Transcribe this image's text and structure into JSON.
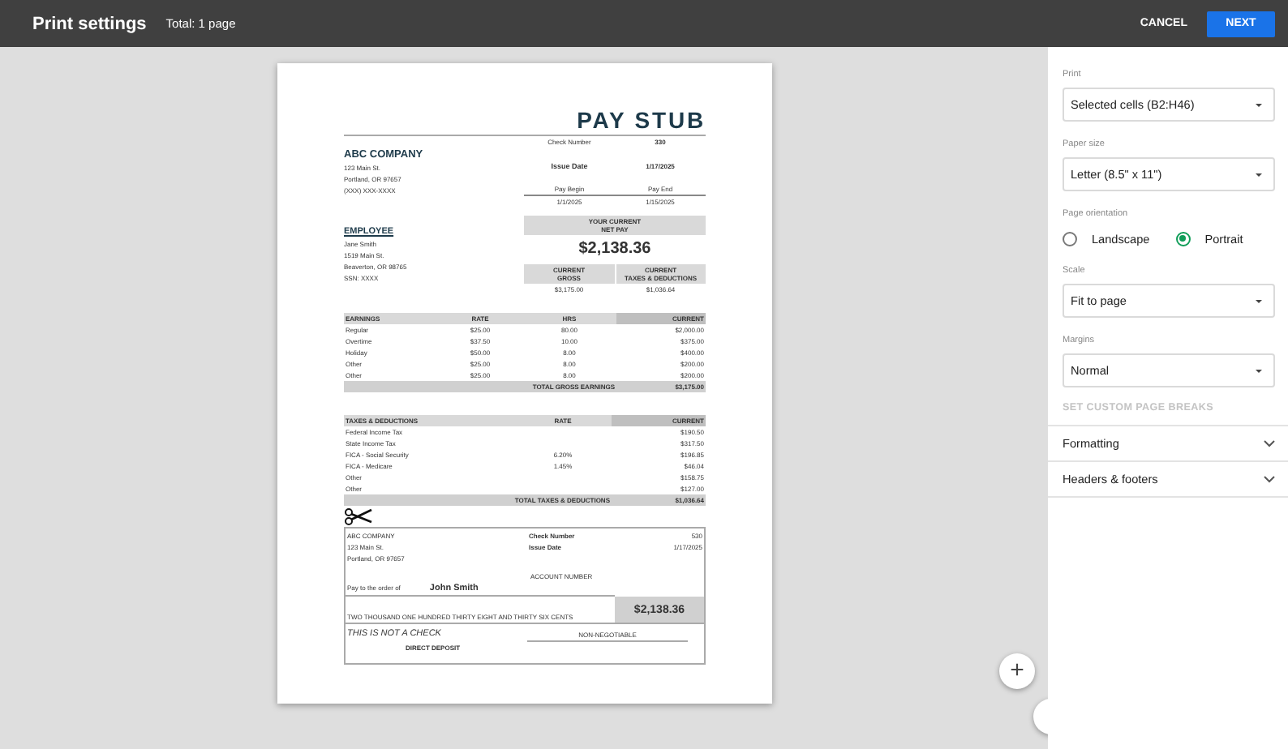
{
  "header": {
    "title": "Print settings",
    "subtitle": "Total: 1 page",
    "buttons": [
      {
        "label": "CANCEL",
        "kind": "text"
      },
      {
        "label": "NEXT",
        "kind": "primary"
      }
    ]
  },
  "preview": {
    "zoom_buttons": [
      "+"
    ],
    "document": {
      "title": "PAY STUB",
      "check_number": {
        "label": "Check Number",
        "value": "330"
      },
      "issue_date": {
        "label": "Issue Date",
        "value": "1/17/2025"
      },
      "pay_period": {
        "columns": [
          "Pay Begin",
          "Pay End"
        ],
        "values": [
          "1/1/2025",
          "1/15/2025"
        ]
      },
      "company": {
        "name": "ABC COMPANY",
        "lines": [
          "123 Main St.",
          "Portland, OR 97657",
          "(XXX) XXX-XXXX"
        ]
      },
      "employee": {
        "heading": "EMPLOYEE",
        "lines": [
          "Jane Smith",
          "1519 Main St.",
          "Beaverton, OR 98765",
          "SSN: XXXX"
        ]
      },
      "net_pay": {
        "label": "YOUR CURRENT\nNET PAY",
        "amount": "$2,138.36"
      },
      "totals": {
        "columns": [
          "CURRENT\nGROSS",
          "CURRENT\nTAXES & DEDUCTIONS"
        ],
        "values": [
          "$3,175.00",
          "$1,036.64"
        ]
      },
      "earnings": {
        "columns": [
          "EARNINGS",
          "RATE",
          "HRS",
          "CURRENT"
        ],
        "rows": [
          {
            "name": "Regular",
            "rate": "$25.00",
            "hrs": "80.00",
            "current": "$2,000.00"
          },
          {
            "name": "Overtime",
            "rate": "$37.50",
            "hrs": "10.00",
            "current": "$375.00"
          },
          {
            "name": "Holiday",
            "rate": "$50.00",
            "hrs": "8.00",
            "current": "$400.00"
          },
          {
            "name": "Other",
            "rate": "$25.00",
            "hrs": "8.00",
            "current": "$200.00"
          },
          {
            "name": "Other",
            "rate": "$25.00",
            "hrs": "8.00",
            "current": "$200.00"
          }
        ],
        "total": {
          "label": "TOTAL GROSS EARNINGS",
          "value": "$3,175.00"
        }
      },
      "deductions": {
        "columns": [
          "TAXES & DEDUCTIONS",
          "RATE",
          "CURRENT"
        ],
        "rows": [
          {
            "name": "Federal Income Tax",
            "current": "$190.50"
          },
          {
            "name": "State Income Tax",
            "current": "$317.50"
          },
          {
            "name": "FICA - Social Security",
            "rate": "6.20%",
            "current": "$196.85"
          },
          {
            "name": "FICA - Medicare",
            "rate": "1.45%",
            "current": "$46.04"
          },
          {
            "name": "Other",
            "current": "$158.75"
          },
          {
            "name": "Other",
            "current": "$127.00"
          }
        ],
        "total": {
          "label": "TOTAL TAXES & DEDUCTIONS",
          "value": "$1,036.64"
        }
      },
      "check": {
        "company": "ABC COMPANY",
        "lines": [
          "123 Main St.",
          "Portland, OR 97657"
        ],
        "check_number": {
          "label": "Check Number",
          "value": "530"
        },
        "issue_date": {
          "label": "Issue Date",
          "value": "1/17/2025"
        },
        "account_label": "ACCOUNT NUMBER",
        "payee_label": "Pay to the order of",
        "payee": "John Smith",
        "amount_words": "TWO THOUSAND ONE HUNDRED THIRTY EIGHT AND THIRTY SIX CENTS",
        "amount": "$2,138.36",
        "notice": "THIS IS NOT A CHECK",
        "non_negotiable": "NON-NEGOTIABLE",
        "deposit": "DIRECT DEPOSIT"
      }
    }
  },
  "settings": {
    "fields": [
      {
        "kind": "select",
        "label": "Print",
        "value": "Selected cells (B2:H46)"
      },
      {
        "kind": "select",
        "label": "Paper size",
        "value": "Letter (8.5\" x 11\")"
      },
      {
        "kind": "radio",
        "label": "Page orientation",
        "options": [
          {
            "label": "Landscape",
            "selected": false
          },
          {
            "label": "Portrait",
            "selected": true
          }
        ]
      },
      {
        "kind": "select",
        "label": "Scale",
        "value": "Fit to page"
      },
      {
        "kind": "select",
        "label": "Margins",
        "value": "Normal"
      },
      {
        "kind": "link",
        "label": "SET CUSTOM PAGE BREAKS",
        "disabled": true
      }
    ],
    "sections": [
      {
        "label": "Formatting",
        "expanded": false
      },
      {
        "label": "Headers & footers",
        "expanded": false
      }
    ]
  }
}
